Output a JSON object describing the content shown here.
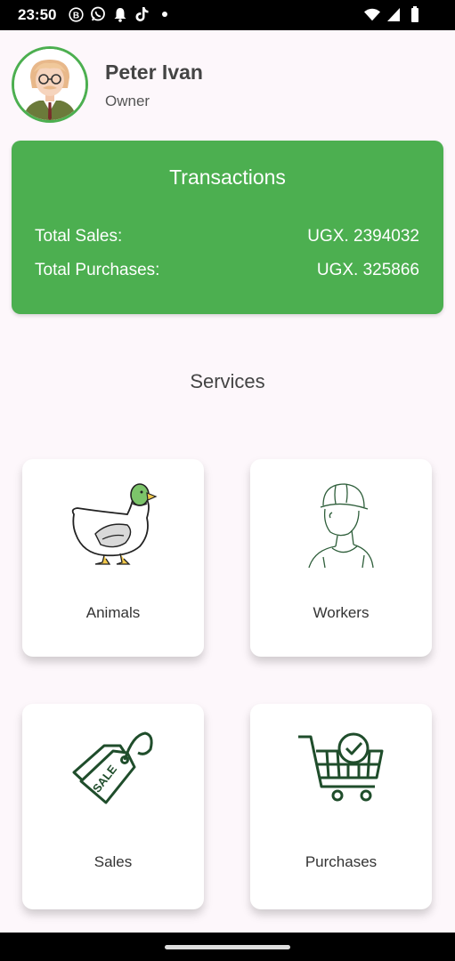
{
  "status_bar": {
    "time": "23:50",
    "left_icons": [
      "b-badge-icon",
      "whatsapp-icon",
      "bell-icon",
      "tiktok-icon",
      "dot-icon"
    ],
    "right_icons": [
      "wifi-icon",
      "signal-icon",
      "battery-icon"
    ]
  },
  "profile": {
    "name": "Peter Ivan",
    "role": "Owner",
    "avatar_icon": "avatar-man-icon"
  },
  "transactions": {
    "title": "Transactions",
    "rows": [
      {
        "label": "Total Sales:",
        "value": "UGX. 2394032"
      },
      {
        "label": "Total Purchases:",
        "value": "UGX. 325866"
      }
    ]
  },
  "services": {
    "title": "Services",
    "items": [
      {
        "label": "Animals",
        "icon": "duck-icon"
      },
      {
        "label": "Workers",
        "icon": "worker-icon"
      },
      {
        "label": "Sales",
        "icon": "sale-tag-icon"
      },
      {
        "label": "Purchases",
        "icon": "shopping-cart-icon"
      }
    ]
  },
  "colors": {
    "accent": "#4caf50",
    "icon_green": "#1f4d2b",
    "background": "#fdf7fb"
  }
}
